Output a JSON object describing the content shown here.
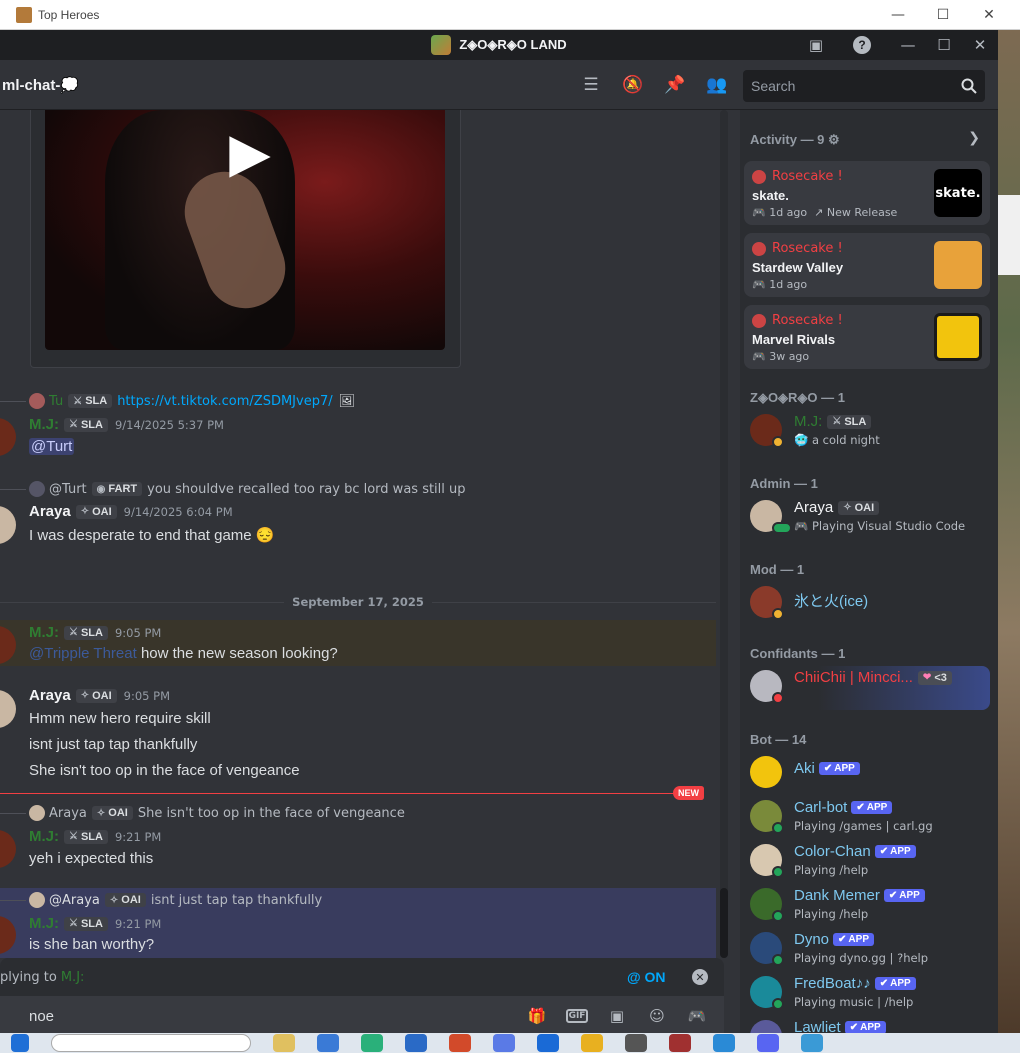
{
  "outer_window": {
    "title": "Top Heroes"
  },
  "discord": {
    "server_title": "Z◈O◈R◈O LAND",
    "channel_name": "ml-chat-💭",
    "search": {
      "placeholder": "Search",
      "value": ""
    }
  },
  "messages": {
    "m1": {
      "reply_author": "Tu",
      "reply_tag": "SLA",
      "reply_text": "https://vt.tiktok.com/ZSDMJvep7/",
      "author": "M.J:",
      "tag": "SLA",
      "time": "9/14/2025 5:37 PM",
      "body_mention": "@Turt"
    },
    "m2": {
      "reply_author": "@Turt",
      "reply_tag": "FART",
      "reply_text": "you shouldve recalled too ray bc lord was still up",
      "author": "Araya",
      "tag": "OAI",
      "time": "9/14/2025 6:04 PM",
      "body": "I was desperate to end that game",
      "emoji": "😔"
    },
    "date_divider": "September 17, 2025",
    "m3": {
      "author": "M.J:",
      "tag": "SLA",
      "time": "9:05 PM",
      "mention": "@Tripple Threat",
      "body": " how the new season looking?"
    },
    "m4": {
      "author": "Araya",
      "tag": "OAI",
      "time": "9:05 PM",
      "lines": [
        "Hmm new hero require skill",
        "isnt just tap tap thankfully",
        "She isn't too op in the face of vengeance"
      ]
    },
    "new_badge": "NEW",
    "m5": {
      "reply_author": "Araya",
      "reply_tag": "OAI",
      "reply_text": "She isn't too op in the face of vengeance",
      "author": "M.J:",
      "tag": "SLA",
      "time": "9:21 PM",
      "body": "yeh i expected this"
    },
    "m6": {
      "reply_author": "@Araya",
      "reply_tag": "OAI",
      "reply_text": "isnt just tap tap thankfully",
      "author": "M.J:",
      "tag": "SLA",
      "time": "9:21 PM",
      "body": "is she ban worthy?"
    }
  },
  "composer": {
    "reply_prefix": "plying to",
    "reply_target": "M.J:",
    "at_on": "@ ON",
    "value": "noe"
  },
  "members": {
    "activity_header": "Activity — 9",
    "activities": [
      {
        "who": "Rosecake !",
        "game": "skate.",
        "meta": "1d ago",
        "extra": "New Release",
        "thumb_text": "skate."
      },
      {
        "who": "Rosecake !",
        "game": "Stardew Valley",
        "meta": "1d ago",
        "extra": "",
        "thumb_text": ""
      },
      {
        "who": "Rosecake !",
        "game": "Marvel Rivals",
        "meta": "3w ago",
        "extra": "",
        "thumb_text": ""
      }
    ],
    "zoro_header": "Z◈O◈R◈O — 1",
    "zoro_member": {
      "name": "M.J:",
      "tag": "SLA",
      "status": "a cold night"
    },
    "admin_header": "Admin — 1",
    "admin_member": {
      "name": "Araya",
      "tag": "OAI",
      "status": "Playing Visual Studio Code"
    },
    "mod_header": "Mod — 1",
    "mod_member": {
      "name": "氷と火(ice)"
    },
    "conf_header": "Confidants — 1",
    "conf_member": {
      "name": "ChiiChii | Mincci...",
      "tag": "<3"
    },
    "bot_header": "Bot — 14",
    "app_label": "APP",
    "bots": [
      {
        "name": "Aki",
        "status": ""
      },
      {
        "name": "Carl-bot",
        "status": "Playing /games | carl.gg"
      },
      {
        "name": "Color-Chan",
        "status": "Playing /help"
      },
      {
        "name": "Dank Memer",
        "status": "Playing /help"
      },
      {
        "name": "Dyno",
        "status": "Playing dyno.gg | ?help"
      },
      {
        "name": "FredBoat♪♪",
        "status": "Playing music | /help"
      },
      {
        "name": "Lawliet",
        "status": ""
      }
    ]
  },
  "colors": {
    "mj_green": "#2f7d32",
    "mention_blue": "#00a8fc",
    "new_red": "#f23f43",
    "app_blurple": "#5865f2"
  }
}
